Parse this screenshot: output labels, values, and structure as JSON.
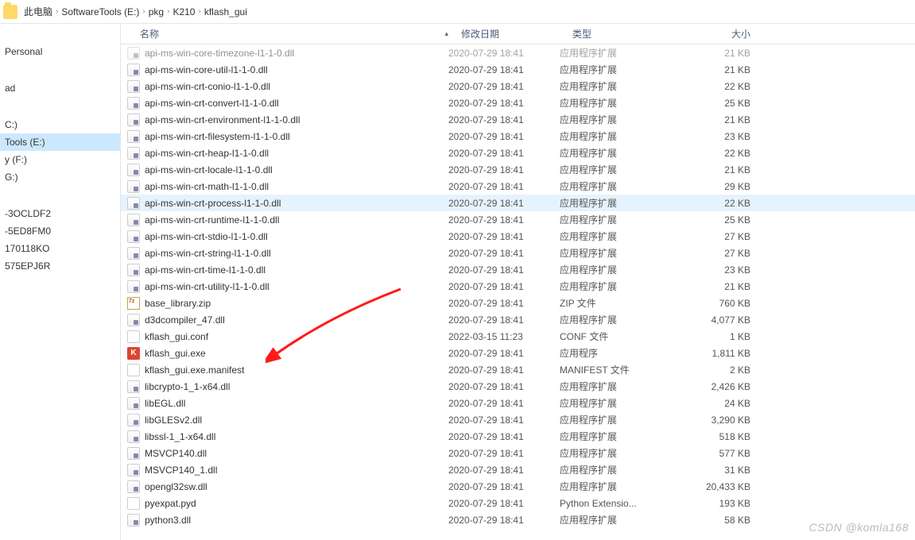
{
  "breadcrumbs": [
    "此电脑",
    "SoftwareTools (E:)",
    "pkg",
    "K210",
    "kflash_gui"
  ],
  "columns": {
    "name": "名称",
    "date": "修改日期",
    "type": "类型",
    "size": "大小"
  },
  "sidebar": [
    {
      "label": "Personal",
      "spacer_before": true
    },
    {
      "label": "ad",
      "spacer_before": true
    },
    {
      "label": "C:)",
      "spacer_before": true
    },
    {
      "label": "Tools (E:)",
      "sel": true
    },
    {
      "label": "y (F:)"
    },
    {
      "label": "G:)"
    },
    {
      "label": "-3OCLDF2",
      "spacer_before": true
    },
    {
      "label": "-5ED8FM0"
    },
    {
      "label": "170118KO"
    },
    {
      "label": "575EPJ6R"
    }
  ],
  "files": [
    {
      "name": "api-ms-win-core-timezone-l1-1-0.dll",
      "date": "2020-07-29 18:41",
      "type": "应用程序扩展",
      "size": "21 KB",
      "icon": "dll",
      "faded": true
    },
    {
      "name": "api-ms-win-core-util-l1-1-0.dll",
      "date": "2020-07-29 18:41",
      "type": "应用程序扩展",
      "size": "21 KB",
      "icon": "dll"
    },
    {
      "name": "api-ms-win-crt-conio-l1-1-0.dll",
      "date": "2020-07-29 18:41",
      "type": "应用程序扩展",
      "size": "22 KB",
      "icon": "dll"
    },
    {
      "name": "api-ms-win-crt-convert-l1-1-0.dll",
      "date": "2020-07-29 18:41",
      "type": "应用程序扩展",
      "size": "25 KB",
      "icon": "dll"
    },
    {
      "name": "api-ms-win-crt-environment-l1-1-0.dll",
      "date": "2020-07-29 18:41",
      "type": "应用程序扩展",
      "size": "21 KB",
      "icon": "dll"
    },
    {
      "name": "api-ms-win-crt-filesystem-l1-1-0.dll",
      "date": "2020-07-29 18:41",
      "type": "应用程序扩展",
      "size": "23 KB",
      "icon": "dll"
    },
    {
      "name": "api-ms-win-crt-heap-l1-1-0.dll",
      "date": "2020-07-29 18:41",
      "type": "应用程序扩展",
      "size": "22 KB",
      "icon": "dll"
    },
    {
      "name": "api-ms-win-crt-locale-l1-1-0.dll",
      "date": "2020-07-29 18:41",
      "type": "应用程序扩展",
      "size": "21 KB",
      "icon": "dll"
    },
    {
      "name": "api-ms-win-crt-math-l1-1-0.dll",
      "date": "2020-07-29 18:41",
      "type": "应用程序扩展",
      "size": "29 KB",
      "icon": "dll"
    },
    {
      "name": "api-ms-win-crt-process-l1-1-0.dll",
      "date": "2020-07-29 18:41",
      "type": "应用程序扩展",
      "size": "22 KB",
      "icon": "dll",
      "hover": true
    },
    {
      "name": "api-ms-win-crt-runtime-l1-1-0.dll",
      "date": "2020-07-29 18:41",
      "type": "应用程序扩展",
      "size": "25 KB",
      "icon": "dll"
    },
    {
      "name": "api-ms-win-crt-stdio-l1-1-0.dll",
      "date": "2020-07-29 18:41",
      "type": "应用程序扩展",
      "size": "27 KB",
      "icon": "dll"
    },
    {
      "name": "api-ms-win-crt-string-l1-1-0.dll",
      "date": "2020-07-29 18:41",
      "type": "应用程序扩展",
      "size": "27 KB",
      "icon": "dll"
    },
    {
      "name": "api-ms-win-crt-time-l1-1-0.dll",
      "date": "2020-07-29 18:41",
      "type": "应用程序扩展",
      "size": "23 KB",
      "icon": "dll"
    },
    {
      "name": "api-ms-win-crt-utility-l1-1-0.dll",
      "date": "2020-07-29 18:41",
      "type": "应用程序扩展",
      "size": "21 KB",
      "icon": "dll"
    },
    {
      "name": "base_library.zip",
      "date": "2020-07-29 18:41",
      "type": "ZIP 文件",
      "size": "760 KB",
      "icon": "zip"
    },
    {
      "name": "d3dcompiler_47.dll",
      "date": "2020-07-29 18:41",
      "type": "应用程序扩展",
      "size": "4,077 KB",
      "icon": "dll"
    },
    {
      "name": "kflash_gui.conf",
      "date": "2022-03-15 11:23",
      "type": "CONF 文件",
      "size": "1 KB",
      "icon": "conf"
    },
    {
      "name": "kflash_gui.exe",
      "date": "2020-07-29 18:41",
      "type": "应用程序",
      "size": "1,811 KB",
      "icon": "exe"
    },
    {
      "name": "kflash_gui.exe.manifest",
      "date": "2020-07-29 18:41",
      "type": "MANIFEST 文件",
      "size": "2 KB",
      "icon": "manifest"
    },
    {
      "name": "libcrypto-1_1-x64.dll",
      "date": "2020-07-29 18:41",
      "type": "应用程序扩展",
      "size": "2,426 KB",
      "icon": "dll"
    },
    {
      "name": "libEGL.dll",
      "date": "2020-07-29 18:41",
      "type": "应用程序扩展",
      "size": "24 KB",
      "icon": "dll"
    },
    {
      "name": "libGLESv2.dll",
      "date": "2020-07-29 18:41",
      "type": "应用程序扩展",
      "size": "3,290 KB",
      "icon": "dll"
    },
    {
      "name": "libssl-1_1-x64.dll",
      "date": "2020-07-29 18:41",
      "type": "应用程序扩展",
      "size": "518 KB",
      "icon": "dll"
    },
    {
      "name": "MSVCP140.dll",
      "date": "2020-07-29 18:41",
      "type": "应用程序扩展",
      "size": "577 KB",
      "icon": "dll"
    },
    {
      "name": "MSVCP140_1.dll",
      "date": "2020-07-29 18:41",
      "type": "应用程序扩展",
      "size": "31 KB",
      "icon": "dll"
    },
    {
      "name": "opengl32sw.dll",
      "date": "2020-07-29 18:41",
      "type": "应用程序扩展",
      "size": "20,433 KB",
      "icon": "dll"
    },
    {
      "name": "pyexpat.pyd",
      "date": "2020-07-29 18:41",
      "type": "Python Extensio...",
      "size": "193 KB",
      "icon": "pyd"
    },
    {
      "name": "python3.dll",
      "date": "2020-07-29 18:41",
      "type": "应用程序扩展",
      "size": "58 KB",
      "icon": "dll"
    }
  ],
  "watermark": "CSDN @komla168"
}
